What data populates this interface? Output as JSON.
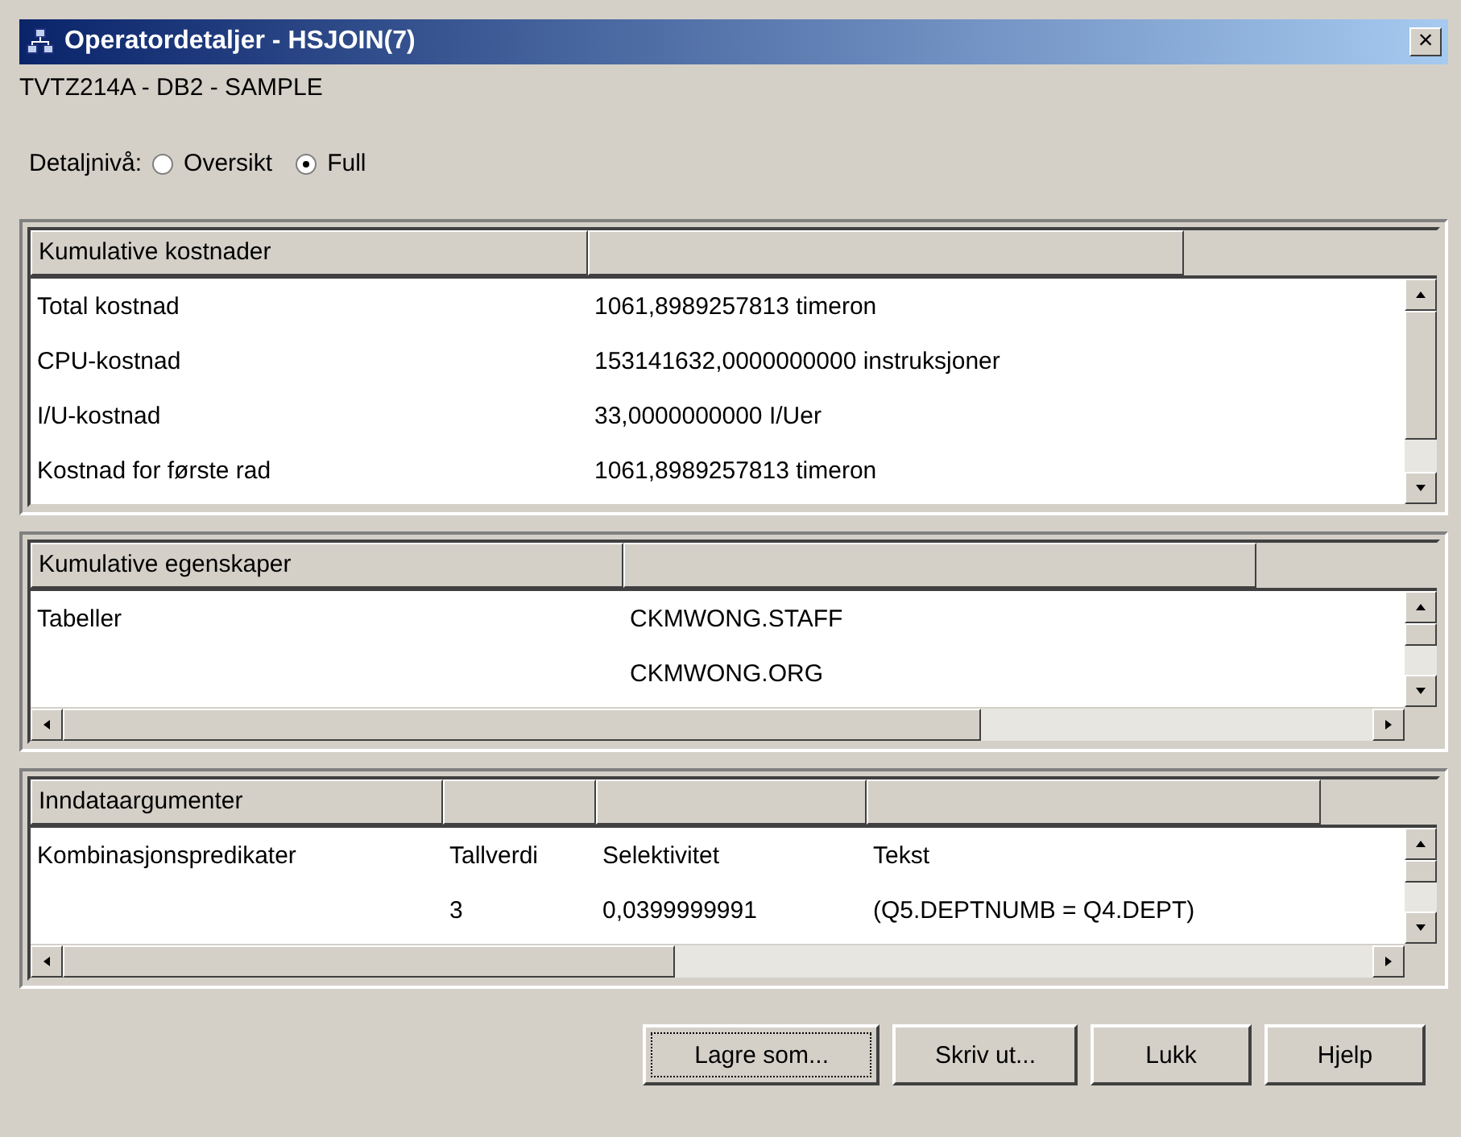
{
  "window": {
    "title": "Operatordetaljer - HSJOIN(7)",
    "close": "×"
  },
  "subtitle": "TVTZ214A - DB2 - SAMPLE",
  "detail_level": {
    "label": "Detaljnivå:",
    "options": [
      {
        "label": "Oversikt",
        "selected": false
      },
      {
        "label": "Full",
        "selected": true
      }
    ]
  },
  "panels": [
    {
      "header": "Kumulative kostnader",
      "horizontal_scroll": false,
      "rows": [
        {
          "cells": [
            "Total kostnad",
            "1061,8989257813 timeron"
          ]
        },
        {
          "cells": [
            "CPU-kostnad",
            "153141632,0000000000 instruksjoner"
          ]
        },
        {
          "cells": [
            "I/U-kostnad",
            "33,0000000000 I/Uer"
          ]
        },
        {
          "cells": [
            "Kostnad for første rad",
            "1061,8989257813 timeron"
          ]
        }
      ]
    },
    {
      "header": "Kumulative egenskaper",
      "horizontal_scroll": true,
      "rows": [
        {
          "cells": [
            "Tabeller",
            "CKMWONG.STAFF"
          ]
        },
        {
          "cells": [
            null,
            "CKMWONG.ORG"
          ]
        }
      ]
    },
    {
      "header": "Inndataargumenter",
      "horizontal_scroll": true,
      "rows": [
        {
          "cells": [
            "Kombinasjonspredikater",
            "Tallverdi",
            "Selektivitet",
            "Tekst"
          ]
        },
        {
          "cells": [
            null,
            "3",
            "0,0399999991",
            "(Q5.DEPTNUMB = Q4.DEPT)"
          ]
        }
      ]
    }
  ],
  "buttons": [
    {
      "label": "Lagre som...",
      "focused": true
    },
    {
      "label": "Skriv ut...",
      "focused": false
    },
    {
      "label": "Lukk",
      "focused": false
    },
    {
      "label": "Hjelp",
      "focused": false
    }
  ]
}
